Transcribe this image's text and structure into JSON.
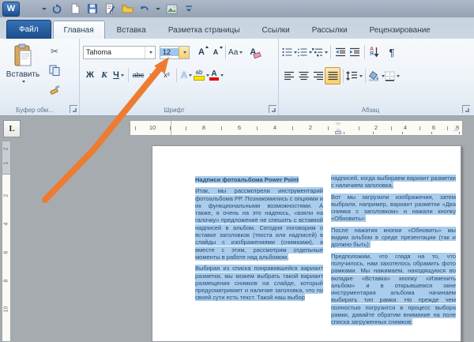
{
  "window": {
    "app_logo": "W"
  },
  "tabs": {
    "file": "Файл",
    "home": "Главная",
    "insert": "Вставка",
    "layout": "Разметка страницы",
    "links": "Ссылки",
    "mailings": "Рассылки",
    "review": "Рецензирование"
  },
  "ribbon": {
    "clipboard": {
      "paste": "Вставить",
      "label": "Буфер обм..."
    },
    "font": {
      "label": "Шрифт",
      "name": "Tahoma",
      "size": "12",
      "bold": "Ж",
      "italic": "К",
      "underline": "Ч",
      "strike": "abc",
      "subscript": "x₂",
      "superscript": "x²",
      "grow": "А",
      "shrink": "А",
      "change_case": "Аа",
      "effects": "А",
      "highlight": "ab",
      "color": "А"
    },
    "paragraph": {
      "label": "Абзац",
      "sort_a": "А",
      "sort_z": "Я",
      "pilcrow": "¶"
    }
  },
  "ruler": {
    "corner": "L",
    "h_left": [
      "10",
      "8",
      "6",
      "4",
      "2"
    ],
    "h_right": [
      "2",
      "4",
      "6",
      "8"
    ],
    "v_top": [
      "2",
      "1"
    ],
    "v_main": [
      "2",
      "4",
      "6",
      "8",
      "10"
    ]
  },
  "doc": {
    "col1": {
      "heading": "Надписи фотоальбома Power Point",
      "p1": "Итак, мы рассмотрели инструментарий фотоальбома PP. Познакомились с опциями и их функциональными возможностями. А также, я очень на это надеюсь, «взяли на галочку» предложение не спешить с вставкой надписей в альбом. Сегодня поговорим о вставке заголовков (текста или надписей) в слайды с изображениями (снимками), а вместе с этим, рассмотрим отдельные моменты в работе над альбомом.",
      "p2": "Выбирая из списка понравившейся вариант разметки, мы можем выбрать такой вариант размещения снимков на слайде, который предусматривает и наличие заголовка, что по своей сути есть текст. Такой наш выбор"
    },
    "col2": {
      "p1": "надписей, когда выбираем вариант разметки с наличием заголовка.",
      "p2": "Вот мы загрузили изображения, затем выбрали, например, вариант разметки «Два снимка с заголовком» и нажали кнопку «Обновить»:",
      "p3": "После нажатия кнопки «Обновить» мы видим альбом в среде презентации (так и должно быть):",
      "p4": "Предположим, что глядя на то, что получилось, нам захотелось обрамить фото рамками. Мы нажимаем, находящуюся во вкладке «Вставка» кнопку «Изменить альбом» и в открывшемся окне инструментария альбома начинаем выбирать тип рамки. Но прежде чем полностью погрузится в процесс выбора рамки, давайте обратим внимание на поле списка загруженных снимков:"
    }
  },
  "colors": {
    "arrow": "#ED7C31",
    "selection": "#abccea",
    "file_tab": "#1c4e8c"
  }
}
